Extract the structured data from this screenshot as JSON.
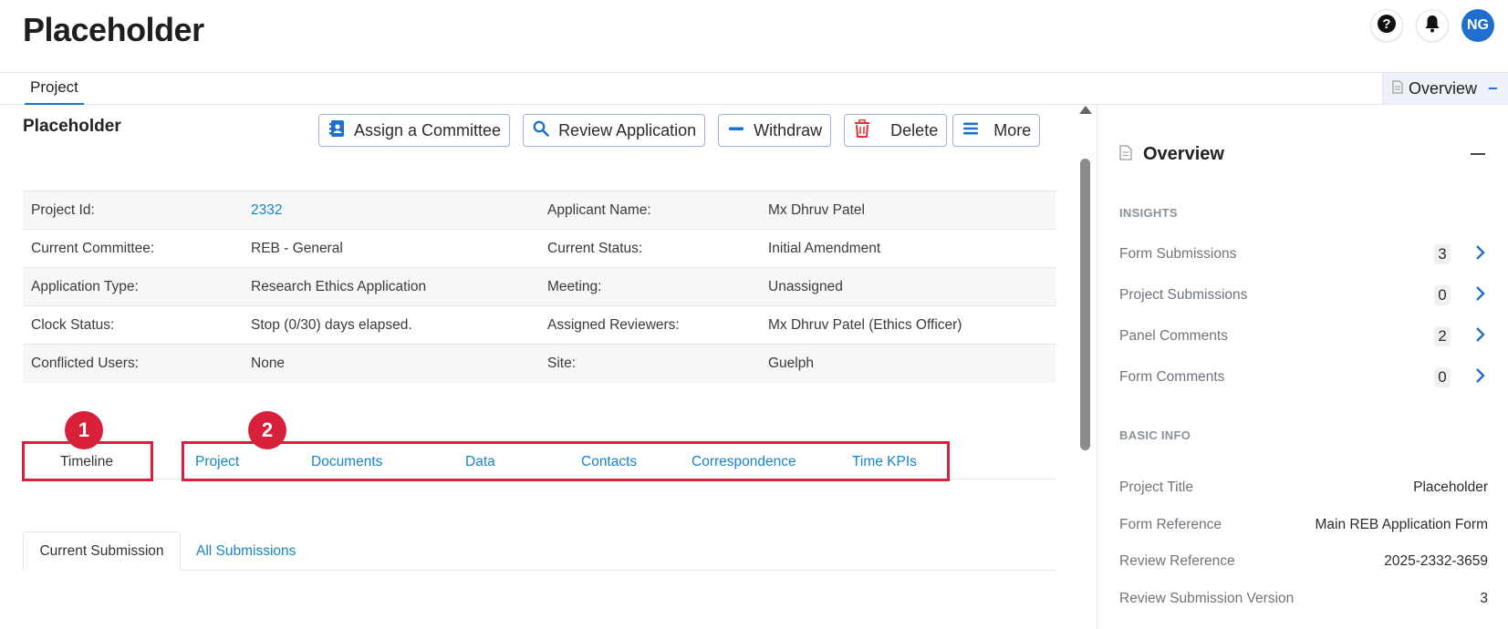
{
  "app": {
    "title": "Placeholder",
    "avatar_initials": "NG",
    "help_icon": "question-icon",
    "bell_icon": "bell-icon"
  },
  "subnav": {
    "tab_label": "Project",
    "overview_label": "Overview",
    "overview_collapse": "−"
  },
  "main": {
    "title": "Placeholder",
    "actions": [
      {
        "label": "Assign a Committee",
        "icon": "committee-icon"
      },
      {
        "label": "Review Application",
        "icon": "search-icon"
      },
      {
        "label": "Withdraw",
        "icon": "minus-icon"
      },
      {
        "label": "Delete",
        "icon": "trash-icon"
      },
      {
        "label": "More",
        "icon": "menu-icon"
      }
    ],
    "info_rows": [
      {
        "l1": "Project Id:",
        "v1": "2332",
        "l2": "Applicant Name:",
        "v2": "Mx Dhruv Patel"
      },
      {
        "l1": "Current Committee:",
        "v1": "REB - General",
        "l2": "Current Status:",
        "v2": "Initial Amendment"
      },
      {
        "l1": "Application Type:",
        "v1": "Research Ethics Application",
        "l2": "Meeting:",
        "v2": "Unassigned"
      },
      {
        "l1": "Clock Status:",
        "v1": "Stop (0/30) days elapsed.",
        "l2": "Assigned Reviewers:",
        "v2": "Mx Dhruv Patel (Ethics Officer)"
      },
      {
        "l1": "Conflicted Users:",
        "v1": "None",
        "l2": "Site:",
        "v2": "Guelph"
      }
    ],
    "annotations": [
      "1",
      "2"
    ],
    "tabs": [
      "Timeline",
      "Project",
      "Documents",
      "Data",
      "Contacts",
      "Correspondence",
      "Time KPIs"
    ],
    "sub_tabs": [
      "Current Submission",
      "All Submissions"
    ]
  },
  "sidebar": {
    "title": "Overview",
    "insights_label": "INSIGHTS",
    "insights": [
      {
        "label": "Form Submissions",
        "count": "3"
      },
      {
        "label": "Project Submissions",
        "count": "0"
      },
      {
        "label": "Panel Comments",
        "count": "2"
      },
      {
        "label": "Form Comments",
        "count": "0"
      }
    ],
    "basic_info_label": "BASIC INFO",
    "basic_info": [
      {
        "label": "Project Title",
        "value": "Placeholder"
      },
      {
        "label": "Form Reference",
        "value": "Main REB Application Form"
      },
      {
        "label": "Review Reference",
        "value": "2025-2332-3659"
      },
      {
        "label": "Review Submission Version",
        "value": "3"
      }
    ]
  },
  "colors": {
    "accent": "#1f6fd1",
    "link": "#1785c6",
    "annotation": "#d9203a",
    "delete": "#e0303a"
  }
}
